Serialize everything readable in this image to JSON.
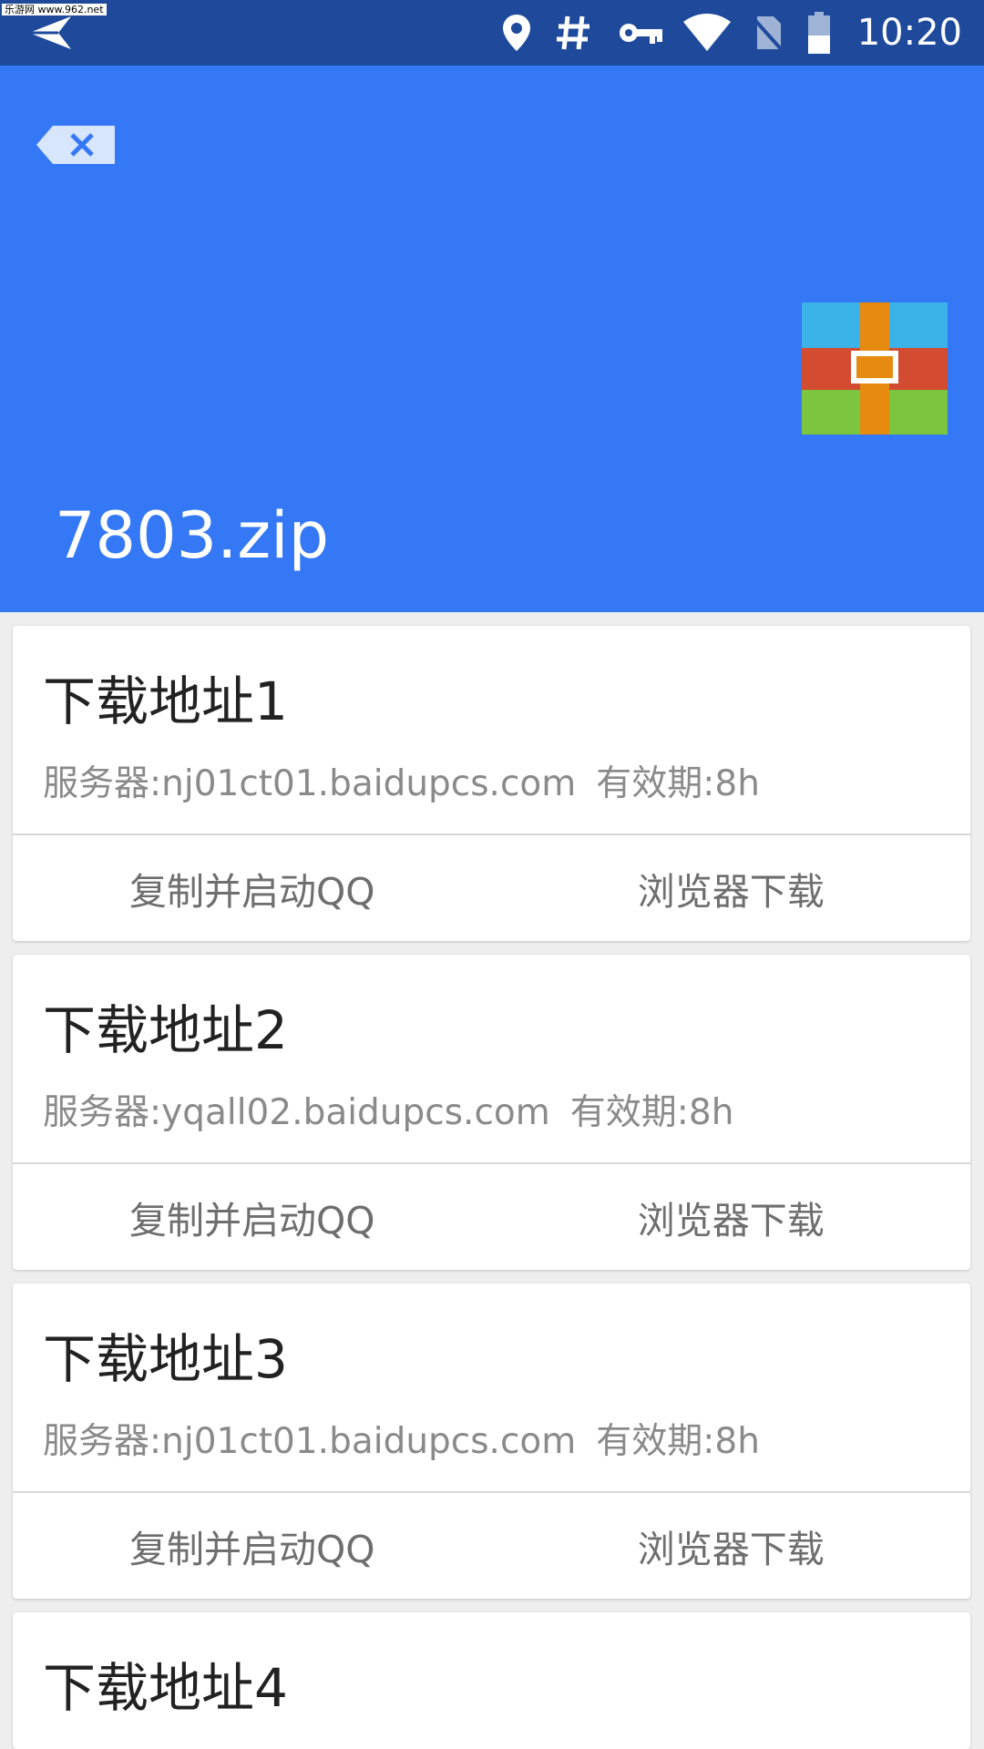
{
  "status_bar": {
    "watermark": "乐游网 www.962.net",
    "time": "10:20",
    "icons": [
      "send-icon",
      "location-icon",
      "hash-icon",
      "vpn-key-icon",
      "wifi-icon",
      "no-sim-icon",
      "battery-icon"
    ]
  },
  "header": {
    "title": "7803.zip",
    "background_color": "#3478f6",
    "back_icon": "backspace-close-icon",
    "file_icon": "archive-icon"
  },
  "cards": [
    {
      "title": "下载地址1",
      "server": "服务器:nj01ct01.baidupcs.com",
      "expiry": "有效期:8h",
      "action_copy": "复制并启动QQ",
      "action_browser": "浏览器下载"
    },
    {
      "title": "下载地址2",
      "server": "服务器:yqall02.baidupcs.com",
      "expiry": "有效期:8h",
      "action_copy": "复制并启动QQ",
      "action_browser": "浏览器下载"
    },
    {
      "title": "下载地址3",
      "server": "服务器:nj01ct01.baidupcs.com",
      "expiry": "有效期:8h",
      "action_copy": "复制并启动QQ",
      "action_browser": "浏览器下载"
    },
    {
      "title": "下载地址4"
    }
  ]
}
